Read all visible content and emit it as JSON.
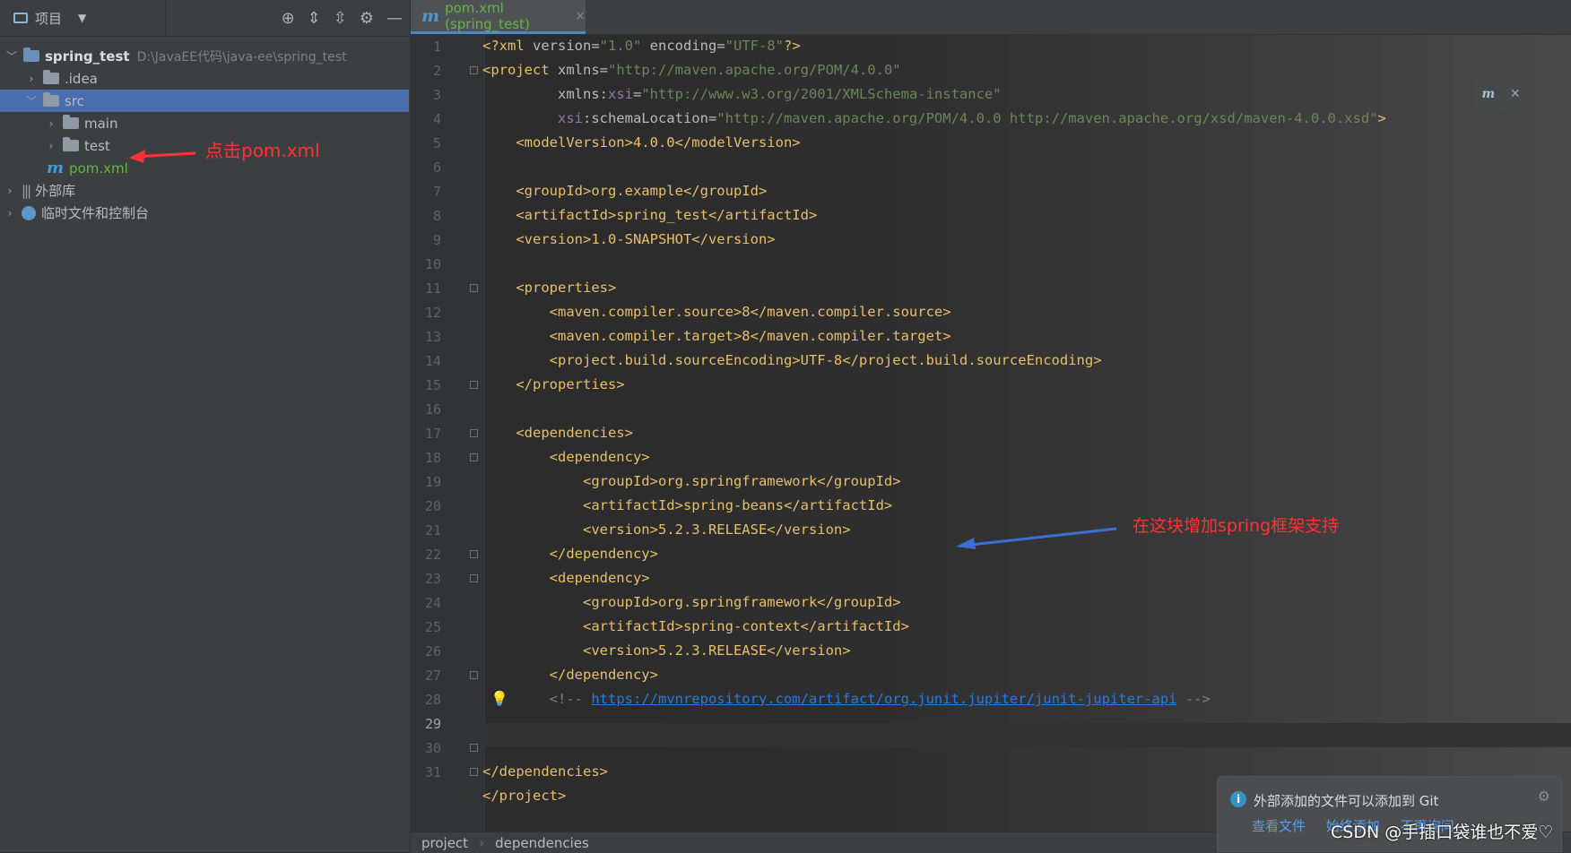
{
  "sidebar": {
    "title": "项目",
    "tree": [
      {
        "label": "spring_test",
        "path": "D:\\JavaEE代码\\java-ee\\spring_test"
      },
      {
        "label": ".idea"
      },
      {
        "label": "src"
      },
      {
        "label": "main"
      },
      {
        "label": "test"
      },
      {
        "label": "pom.xml"
      },
      {
        "label": "外部库"
      },
      {
        "label": "临时文件和控制台"
      }
    ],
    "annotation": "点击pom.xml"
  },
  "editor": {
    "tab": {
      "title": "pom.xml (spring_test)",
      "close": "×"
    },
    "current_line": 29,
    "lines": [
      {
        "n": "1"
      },
      {
        "n": "2"
      },
      {
        "n": "3"
      },
      {
        "n": "4"
      },
      {
        "n": "5"
      },
      {
        "n": "6"
      },
      {
        "n": "7"
      },
      {
        "n": "8"
      },
      {
        "n": "9"
      },
      {
        "n": "10"
      },
      {
        "n": "11"
      },
      {
        "n": "12"
      },
      {
        "n": "13"
      },
      {
        "n": "14"
      },
      {
        "n": "15"
      },
      {
        "n": "16"
      },
      {
        "n": "17"
      },
      {
        "n": "18"
      },
      {
        "n": "19"
      },
      {
        "n": "20"
      },
      {
        "n": "21"
      },
      {
        "n": "22"
      },
      {
        "n": "23"
      },
      {
        "n": "24"
      },
      {
        "n": "25"
      },
      {
        "n": "26"
      },
      {
        "n": "27"
      },
      {
        "n": "28"
      },
      {
        "n": "29"
      },
      {
        "n": "30"
      },
      {
        "n": "31"
      }
    ],
    "code": {
      "l1": "<?xml version=\"1.0\" encoding=\"UTF-8\"?>",
      "l2": "<project xmlns=\"http://maven.apache.org/POM/4.0.0\"",
      "l3": "         xmlns:xsi=\"http://www.w3.org/2001/XMLSchema-instance\"",
      "l4": "         xsi:schemaLocation=\"http://maven.apache.org/POM/4.0.0 http://maven.apache.org/xsd/maven-4.0.0.xsd\">",
      "l5": "    <modelVersion>4.0.0</modelVersion>",
      "l7": "    <groupId>org.example</groupId>",
      "l8": "    <artifactId>spring_test</artifactId>",
      "l9": "    <version>1.0-SNAPSHOT</version>",
      "l11": "    <properties>",
      "l12": "        <maven.compiler.source>8</maven.compiler.source>",
      "l13": "        <maven.compiler.target>8</maven.compiler.target>",
      "l14": "        <project.build.sourceEncoding>UTF-8</project.build.sourceEncoding>",
      "l15": "    </properties>",
      "l17": "    <dependencies>",
      "l18": "        <dependency>",
      "l19": "            <groupId>org.springframework</groupId>",
      "l20": "            <artifactId>spring-beans</artifactId>",
      "l21": "            <version>5.2.3.RELEASE</version>",
      "l22": "        </dependency>",
      "l23": "        <dependency>",
      "l24": "            <groupId>org.springframework</groupId>",
      "l25": "            <artifactId>spring-context</artifactId>",
      "l26": "            <version>5.2.3.RELEASE</version>",
      "l27": "        </dependency>",
      "l28_pre": "        <!-- ",
      "l28_link": "https://mvnrepository.com/artifact/org.junit.jupiter/junit-jupiter-api",
      "l28_post": " -->",
      "l30": "</dependencies>",
      "l31": "</project>"
    },
    "annotation": "在这块增加spring框架支持"
  },
  "breadcrumb": [
    "project",
    "dependencies"
  ],
  "notification": {
    "message": "外部添加的文件可以添加到 Git",
    "links": [
      "查看文件",
      "始终添加",
      "不再询问"
    ]
  },
  "watermark": "CSDN @手插口袋谁也不爱♡",
  "colors": {
    "tag": "#e8bf6a",
    "string": "#6a8759",
    "namespace": "#9876aa",
    "comment": "#808080",
    "link": "#287bde",
    "annotation_red": "#ff3333",
    "arrow_blue": "#3b6fd8"
  }
}
